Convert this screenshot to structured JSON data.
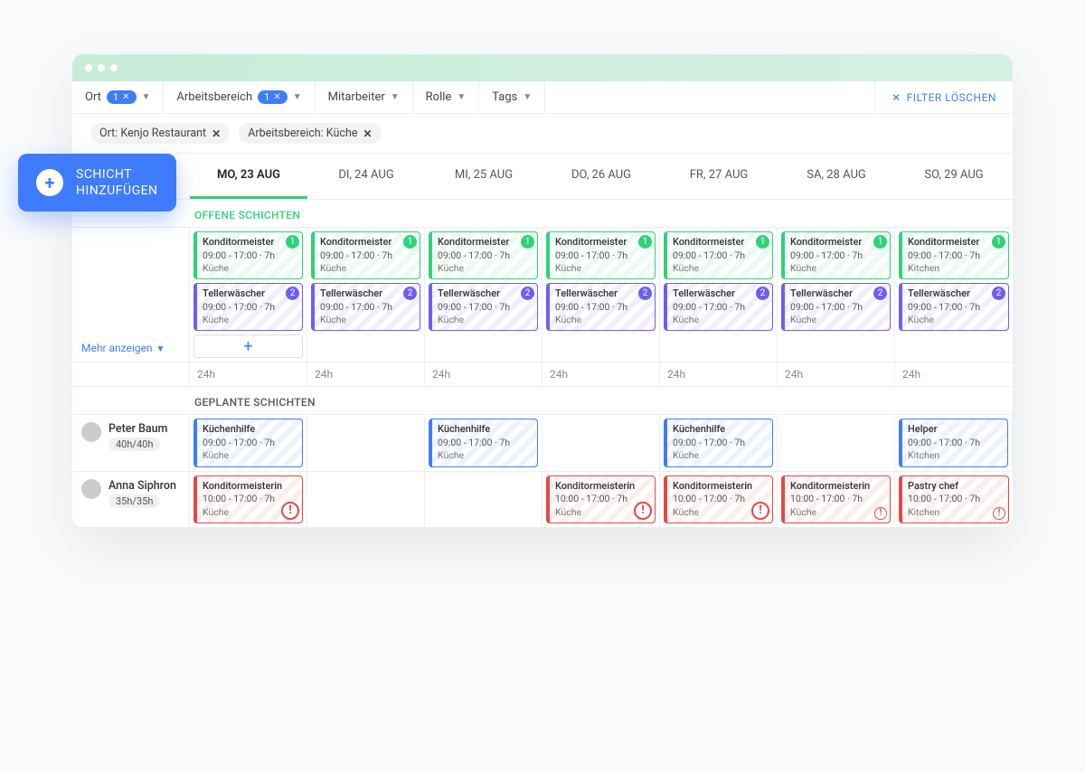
{
  "colors": {
    "primary": "#3f7cfb",
    "green": "#2fd27a",
    "purple": "#6d5ef6",
    "red": "#e64848"
  },
  "addShift": {
    "line1": "SCHICHT",
    "line2": "HINZUFÜGEN"
  },
  "filters": {
    "ort": {
      "label": "Ort",
      "count": "1"
    },
    "arbeitsbereich": {
      "label": "Arbeitsbereich",
      "count": "1"
    },
    "mitarbeiter": "Mitarbeiter",
    "rolle": "Rolle",
    "tags": "Tags",
    "clear": "FILTER LÖSCHEN"
  },
  "chips": {
    "ort": "Ort: Kenjo Restaurant",
    "bereich": "Arbeitsbereich: Küche"
  },
  "days": [
    "MO, 23 AUG",
    "DI, 24 AUG",
    "MI, 25 AUG",
    "DO, 26 AUG",
    "FR, 27 AUG",
    "SA, 28 AUG",
    "SO, 29 AUG"
  ],
  "sections": {
    "open": "OFFENE SCHICHTEN",
    "planned": "GEPLANTE SCHICHTEN"
  },
  "showMore": "Mehr anzeigen",
  "openShifts": {
    "row1": [
      {
        "role": "Konditormeister",
        "time": "09:00 - 17:00 · 7h",
        "area": "Küche",
        "count": "1",
        "style": "green"
      },
      {
        "role": "Konditormeister",
        "time": "09:00 - 17:00 · 7h",
        "area": "Küche",
        "count": "1",
        "style": "green"
      },
      {
        "role": "Konditormeister",
        "time": "09:00 - 17:00 · 7h",
        "area": "Küche",
        "count": "1",
        "style": "green"
      },
      {
        "role": "Konditormeister",
        "time": "09:00 - 17:00 · 7h",
        "area": "Küche",
        "count": "1",
        "style": "green"
      },
      {
        "role": "Konditormeister",
        "time": "09:00 - 17:00 · 7h",
        "area": "Küche",
        "count": "1",
        "style": "green"
      },
      {
        "role": "Konditormeister",
        "time": "09:00 - 17:00 · 7h",
        "area": "Küche",
        "count": "1",
        "style": "green"
      },
      {
        "role": "Konditormeister",
        "time": "09:00 - 17:00 · 7h",
        "area": "Kitchen",
        "count": "1",
        "style": "green"
      }
    ],
    "row2": [
      {
        "role": "Tellerwäscher",
        "time": "09:00 - 17:00 · 7h",
        "area": "Küche",
        "count": "2",
        "style": "purple"
      },
      {
        "role": "Tellerwäscher",
        "time": "09:00 - 17:00 · 7h",
        "area": "Küche",
        "count": "2",
        "style": "purple"
      },
      {
        "role": "Tellerwäscher",
        "time": "09:00 - 17:00 · 7h",
        "area": "Küche",
        "count": "2",
        "style": "purple"
      },
      {
        "role": "Tellerwäscher",
        "time": "09:00 - 17:00 · 7h",
        "area": "Küche",
        "count": "2",
        "style": "purple"
      },
      {
        "role": "Tellerwäscher",
        "time": "09:00 - 17:00 · 7h",
        "area": "Küche",
        "count": "2",
        "style": "purple"
      },
      {
        "role": "Tellerwäscher",
        "time": "09:00 - 17:00 · 7h",
        "area": "Küche",
        "count": "2",
        "style": "purple"
      },
      {
        "role": "Tellerwäscher",
        "time": "09:00 - 17:00 · 7h",
        "area": "Küche",
        "count": "2",
        "style": "purple"
      }
    ]
  },
  "totals": [
    "24h",
    "24h",
    "24h",
    "24h",
    "24h",
    "24h",
    "24h"
  ],
  "plannedShifts": {
    "rows": [
      {
        "name": "Peter Baum",
        "hours": "40h/40h",
        "cells": [
          {
            "role": "Küchenhilfe",
            "time": "09:00 - 17:00 · 7h",
            "area": "Küche",
            "style": "blue"
          },
          null,
          {
            "role": "Küchenhilfe",
            "time": "09:00 - 17:00 · 7h",
            "area": "Küche",
            "style": "blue"
          },
          null,
          {
            "role": "Küchenhilfe",
            "time": "09:00 - 17:00 · 7h",
            "area": "Küche",
            "style": "blue"
          },
          null,
          {
            "role": "Helper",
            "time": "09:00 - 17:00 · 7h",
            "area": "Kitchen",
            "style": "blue"
          }
        ]
      },
      {
        "name": "Anna Siphron",
        "hours": "35h/35h",
        "cells": [
          {
            "role": "Konditormeisterin",
            "time": "10:00 - 17:00 · 7h",
            "area": "Küche",
            "style": "red",
            "alert": "big"
          },
          null,
          null,
          {
            "role": "Konditormeisterin",
            "time": "10:00 - 17:00 · 7h",
            "area": "Küche",
            "style": "red",
            "alert": "big"
          },
          {
            "role": "Konditormeisterin",
            "time": "10:00 - 17:00 · 7h",
            "area": "Küche",
            "style": "red",
            "alert": "big"
          },
          {
            "role": "Konditormeisterin",
            "time": "10:00 - 17:00 · 7h",
            "area": "Küche",
            "style": "red",
            "alert": "small"
          },
          {
            "role": "Pastry chef",
            "time": "10:00 - 17:00 · 7h",
            "area": "Kitchen",
            "style": "red",
            "alert": "small"
          }
        ]
      }
    ]
  }
}
